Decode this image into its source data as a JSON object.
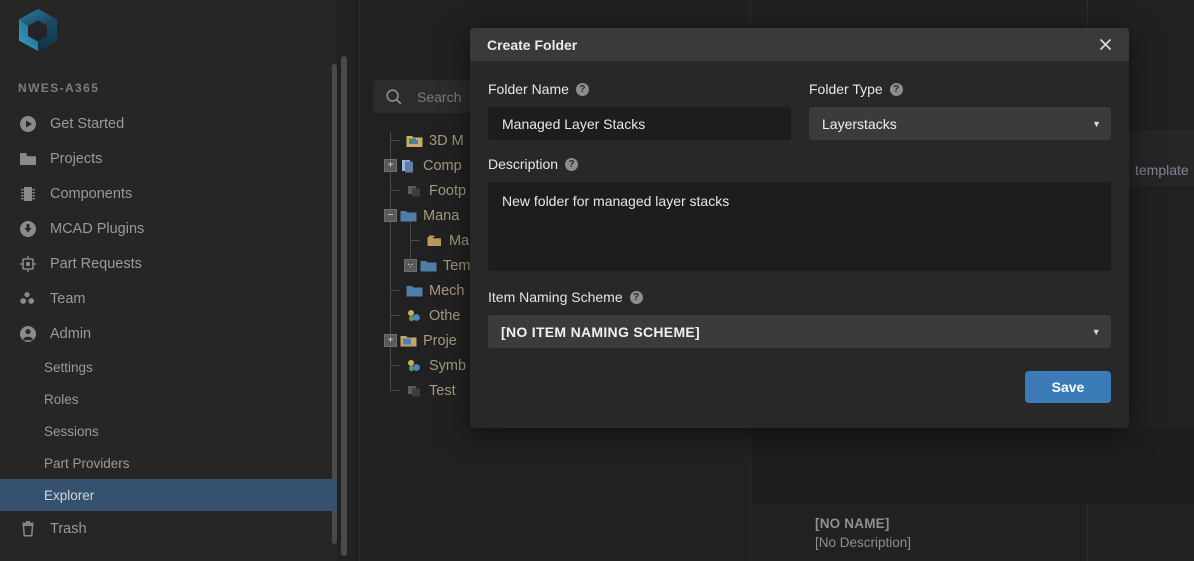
{
  "sidebar": {
    "logo_name": "app-logo-cube",
    "org_name": "NWES-A365",
    "items": [
      {
        "label": "Get Started",
        "icon": "play-circle-icon",
        "sub": false,
        "active": false
      },
      {
        "label": "Projects",
        "icon": "folder-icon",
        "sub": false,
        "active": false
      },
      {
        "label": "Components",
        "icon": "chip-icon",
        "sub": false,
        "active": false
      },
      {
        "label": "MCAD Plugins",
        "icon": "download-circle-icon",
        "sub": false,
        "active": false
      },
      {
        "label": "Part Requests",
        "icon": "cpu-icon",
        "sub": false,
        "active": false
      },
      {
        "label": "Team",
        "icon": "people-icon",
        "sub": false,
        "active": false
      },
      {
        "label": "Admin",
        "icon": "user-circle-icon",
        "sub": false,
        "active": false
      },
      {
        "label": "Settings",
        "icon": "",
        "sub": true,
        "active": false
      },
      {
        "label": "Roles",
        "icon": "",
        "sub": true,
        "active": false
      },
      {
        "label": "Sessions",
        "icon": "",
        "sub": true,
        "active": false
      },
      {
        "label": "Part Providers",
        "icon": "",
        "sub": true,
        "active": false
      },
      {
        "label": "Explorer",
        "icon": "",
        "sub": true,
        "active": true
      },
      {
        "label": "Trash",
        "icon": "trash-icon",
        "sub": false,
        "active": false
      }
    ]
  },
  "main": {
    "search": {
      "placeholder": "Search",
      "icon": "search-icon"
    },
    "tree": [
      {
        "label": "3D M",
        "depth": 0,
        "toggle": "none",
        "icon": "folder-3d-icon"
      },
      {
        "label": "Comp",
        "depth": 0,
        "toggle": "expand",
        "icon": "components-icon"
      },
      {
        "label": "Footp",
        "depth": 0,
        "toggle": "none",
        "icon": "footprint-icon"
      },
      {
        "label": "Mana",
        "depth": 0,
        "toggle": "collapse",
        "icon": "folder-blue-icon"
      },
      {
        "label": "Mar",
        "depth": 1,
        "toggle": "none",
        "icon": "folder-tan-icon"
      },
      {
        "label": "Tem",
        "depth": 1,
        "toggle": "expand",
        "icon": "folder-blue-icon"
      },
      {
        "label": "Mech",
        "depth": 0,
        "toggle": "none",
        "icon": "folder-blue-icon"
      },
      {
        "label": "Othe",
        "depth": 0,
        "toggle": "none",
        "icon": "symbol-icon"
      },
      {
        "label": "Proje",
        "depth": 0,
        "toggle": "expand",
        "icon": "folder-project-icon"
      },
      {
        "label": "Symb",
        "depth": 0,
        "toggle": "none",
        "icon": "symbol-icon"
      },
      {
        "label": "Test",
        "depth": 0,
        "toggle": "none",
        "icon": "footprint-icon"
      }
    ],
    "right_card_text": "template",
    "detail": {
      "name": "[NO NAME]",
      "description": "[No Description]"
    }
  },
  "modal": {
    "title": "Create Folder",
    "close_icon": "close-icon",
    "help_icon": "help-icon",
    "folder_name": {
      "label": "Folder Name",
      "value": "Managed Layer Stacks",
      "placeholder": ""
    },
    "folder_type": {
      "label": "Folder Type",
      "value": "Layerstacks",
      "caret_icon": "chevron-down-icon"
    },
    "description": {
      "label": "Description",
      "value": "New folder for managed layer stacks",
      "placeholder": ""
    },
    "item_naming_scheme": {
      "label": "Item Naming Scheme",
      "value": "[NO ITEM NAMING SCHEME]",
      "caret_icon": "chevron-down-icon"
    },
    "save_label": "Save"
  },
  "colors": {
    "accent_blue": "#3b7cb8",
    "active_nav": "#35516e",
    "sidebar_bg": "#262626",
    "modal_bg": "#282828",
    "modal_header": "#3a3a3a"
  }
}
